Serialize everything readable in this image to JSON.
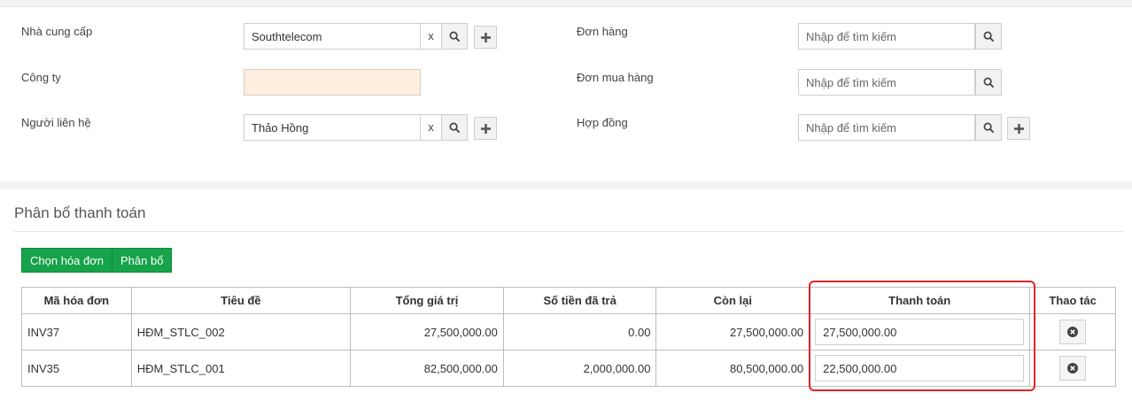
{
  "form": {
    "supplier": {
      "label": "Nhà cung cấp",
      "value": "Southtelecom",
      "clear": "x"
    },
    "company": {
      "label": "Công ty",
      "value": ""
    },
    "contact": {
      "label": "Người liên hệ",
      "value": "Thảo Hồng",
      "clear": "x"
    },
    "order": {
      "label": "Đơn hàng",
      "placeholder": "Nhập để tìm kiếm"
    },
    "purchase_order": {
      "label": "Đơn mua hàng",
      "placeholder": "Nhập để tìm kiếm"
    },
    "contract": {
      "label": "Hợp đồng",
      "placeholder": "Nhập để tìm kiếm"
    }
  },
  "allocation": {
    "title": "Phân bổ thanh toán",
    "buttons": {
      "select_invoice": "Chọn hóa đơn",
      "allocate": "Phân bổ"
    },
    "columns": [
      "Mã hóa đơn",
      "Tiêu đề",
      "Tổng giá trị",
      "Số tiền đã trả",
      "Còn lại",
      "Thanh toán",
      "Thao tác"
    ],
    "rows": [
      {
        "invoice": "INV37",
        "title": "HĐM_STLC_002",
        "total": "27,500,000.00",
        "paid": "0.00",
        "remaining": "27,500,000.00",
        "payment": "27,500,000.00"
      },
      {
        "invoice": "INV35",
        "title": "HĐM_STLC_001",
        "total": "82,500,000.00",
        "paid": "2,000,000.00",
        "remaining": "80,500,000.00",
        "payment": "22,500,000.00"
      }
    ]
  },
  "colors": {
    "primary_button": "#16a34a",
    "highlight": "#e32424",
    "readonly_field": "#ffeedd"
  },
  "icons": {
    "search": "search-icon",
    "add": "plus-icon",
    "delete": "close-circle-icon"
  }
}
